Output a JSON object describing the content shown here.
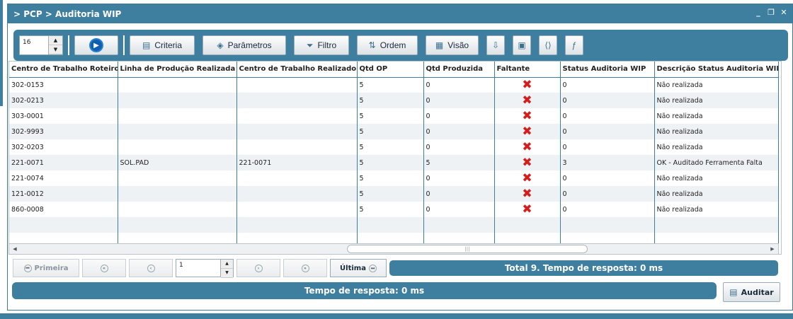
{
  "window": {
    "title": "> PCP > Auditoria WIP",
    "controls": {
      "minimize": "_",
      "restore": "❐",
      "close": "✕"
    }
  },
  "toolbar": {
    "page_size": "16",
    "buttons": {
      "criteria": "Criteria",
      "parametros": "Parâmetros",
      "filtro": "Filtro",
      "ordem": "Ordem",
      "visao": "Visão"
    }
  },
  "grid": {
    "columns": [
      "Centro de Trabalho Roteiro",
      "Linha de Produção Realizada",
      "Centro de Trabalho Realizado",
      "Qtd OP",
      "Qtd Produzida",
      "Faltante",
      "Status Auditoria WIP",
      "Descrição Status Auditoria WIP"
    ],
    "rows": [
      {
        "centro_roteiro": "302-0153",
        "linha": "",
        "centro_realizado": "",
        "qtd_op": "5",
        "qtd_produzida": "0",
        "faltante": "✖",
        "status": "0",
        "descricao": "Não realizada"
      },
      {
        "centro_roteiro": "302-0213",
        "linha": "",
        "centro_realizado": "",
        "qtd_op": "5",
        "qtd_produzida": "0",
        "faltante": "✖",
        "status": "0",
        "descricao": "Não realizada"
      },
      {
        "centro_roteiro": "303-0001",
        "linha": "",
        "centro_realizado": "",
        "qtd_op": "5",
        "qtd_produzida": "0",
        "faltante": "✖",
        "status": "0",
        "descricao": "Não realizada"
      },
      {
        "centro_roteiro": "302-9993",
        "linha": "",
        "centro_realizado": "",
        "qtd_op": "5",
        "qtd_produzida": "0",
        "faltante": "✖",
        "status": "0",
        "descricao": "Não realizada"
      },
      {
        "centro_roteiro": "302-0203",
        "linha": "",
        "centro_realizado": "",
        "qtd_op": "5",
        "qtd_produzida": "0",
        "faltante": "✖",
        "status": "0",
        "descricao": "Não realizada"
      },
      {
        "centro_roteiro": "221-0071",
        "linha": "SOL.PAD",
        "centro_realizado": "221-0071",
        "qtd_op": "5",
        "qtd_produzida": "5",
        "faltante": "✖",
        "status": "3",
        "descricao": "OK - Auditado Ferramenta Falta"
      },
      {
        "centro_roteiro": "221-0074",
        "linha": "",
        "centro_realizado": "",
        "qtd_op": "5",
        "qtd_produzida": "0",
        "faltante": "✖",
        "status": "0",
        "descricao": "Não realizada"
      },
      {
        "centro_roteiro": "121-0012",
        "linha": "",
        "centro_realizado": "",
        "qtd_op": "5",
        "qtd_produzida": "0",
        "faltante": "✖",
        "status": "0",
        "descricao": "Não realizada"
      },
      {
        "centro_roteiro": "860-0008",
        "linha": "",
        "centro_realizado": "",
        "qtd_op": "5",
        "qtd_produzida": "0",
        "faltante": "✖",
        "status": "0",
        "descricao": "Não realizada"
      }
    ]
  },
  "pager": {
    "first_label": "Primeira",
    "last_label": "Última",
    "page": "1"
  },
  "total_text": "Total 9. Tempo de resposta: 0 ms",
  "status_text": "Tempo de resposta: 0 ms",
  "auditar_label": "Auditar"
}
